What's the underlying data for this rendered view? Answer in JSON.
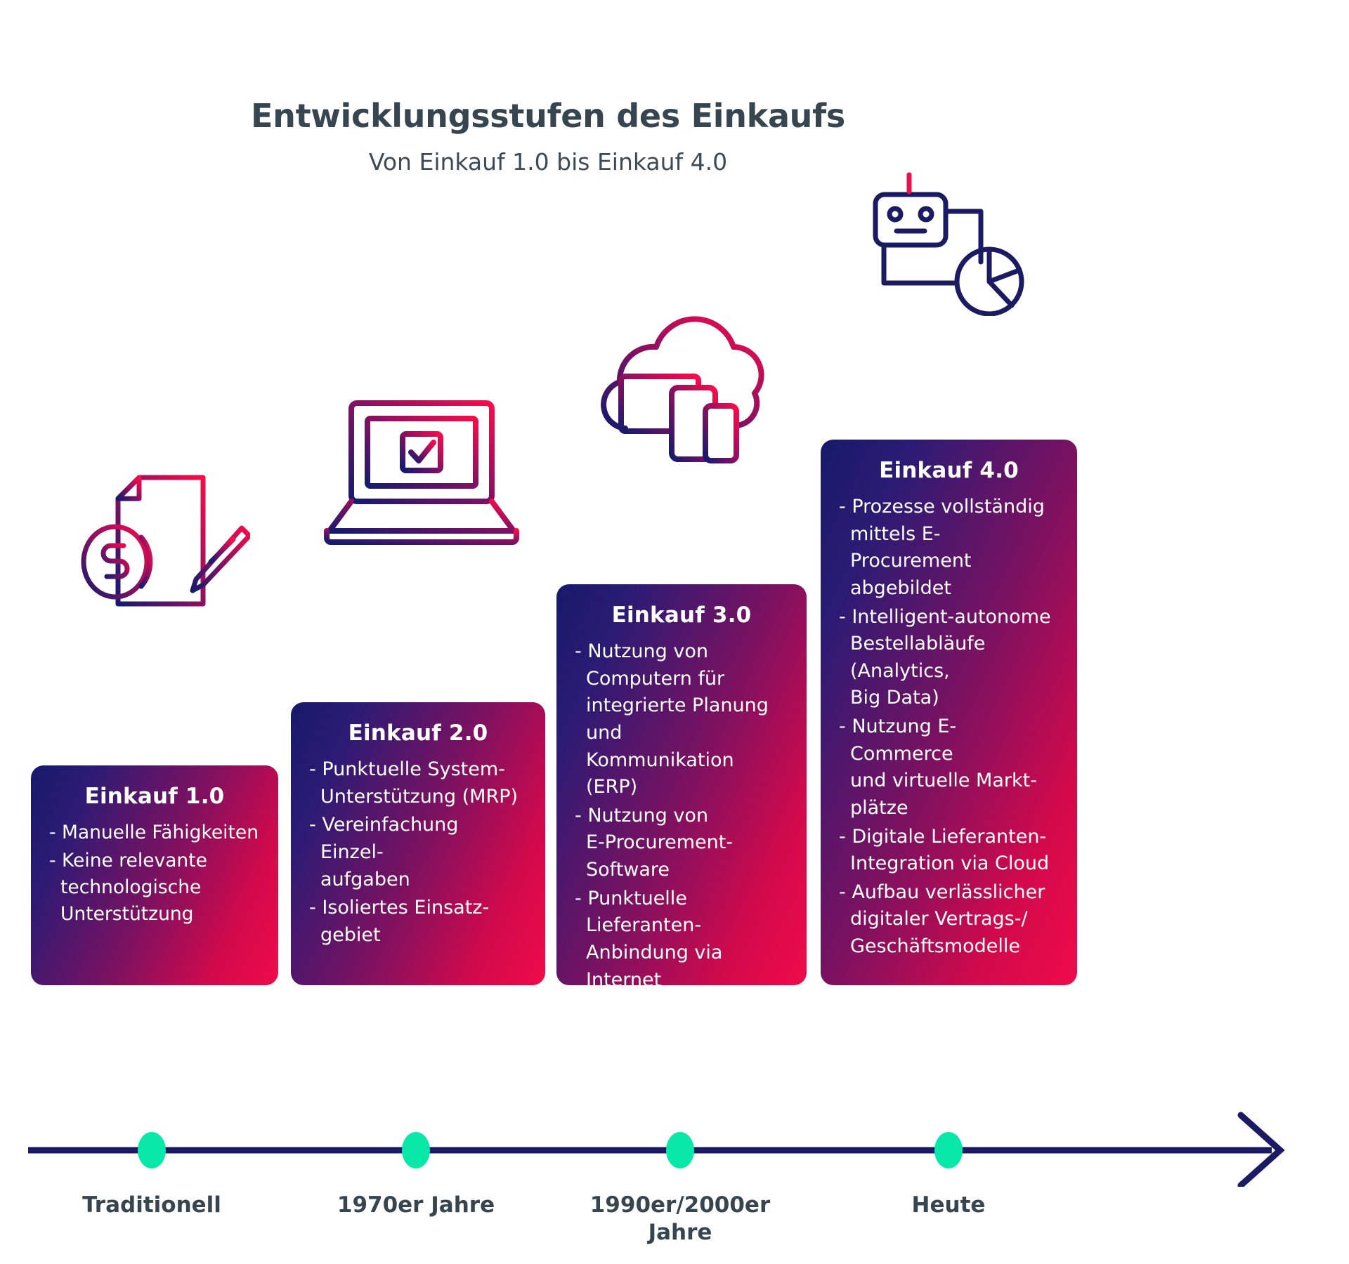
{
  "header": {
    "title": "Entwicklungsstufen des Einkaufs",
    "subtitle": "Von Einkauf 1.0 bis Einkauf 4.0"
  },
  "colors": {
    "gradient_start": "#171a6b",
    "gradient_end": "#f00b4a",
    "heading_text": "#36454f",
    "timeline_line": "#1b1b63",
    "timeline_dot": "#07e8a9",
    "card_text": "#ffffff"
  },
  "stages": [
    {
      "id": "einkauf-1",
      "title": "Einkauf 1.0",
      "icon": "document-coin-chart-pencil-icon",
      "bullets": [
        "- Manuelle Fähigkeiten",
        "- Keine relevante\ntechnologische\nUnterstützung"
      ]
    },
    {
      "id": "einkauf-2",
      "title": "Einkauf 2.0",
      "icon": "laptop-checkmark-icon",
      "bullets": [
        "- Punktuelle System-\nUnterstützung (MRP)",
        "- Vereinfachung Einzel-\naufgaben",
        "- Isoliertes Einsatz-\ngebiet"
      ]
    },
    {
      "id": "einkauf-3",
      "title": "Einkauf 3.0",
      "icon": "cloud-devices-icon",
      "bullets": [
        "- Nutzung von\nComputern für\nintegrierte Planung und\nKommunikation (ERP)",
        "- Nutzung von\nE-Procurement-\nSoftware",
        "- Punktuelle Lieferanten-\nAnbindung via Internet"
      ]
    },
    {
      "id": "einkauf-4",
      "title": "Einkauf 4.0",
      "icon": "robot-piechart-icon",
      "bullets": [
        "- Prozesse vollständig\nmittels E-Procurement\nabgebildet",
        "- Intelligent-autonome\nBestellabläufe (Analytics,\nBig Data)",
        "- Nutzung E-Commerce\nund virtuelle Markt-\nplätze",
        "- Digitale Lieferanten-\nIntegration via Cloud",
        "- Aufbau verlässlicher\ndigitaler Vertrags-/\nGeschäftsmodelle"
      ]
    }
  ],
  "timeline": {
    "arrow_icon": "arrow-right-icon",
    "points": [
      {
        "label": "Traditionell"
      },
      {
        "label": "1970er Jahre"
      },
      {
        "label": "1990er/2000er\nJahre"
      },
      {
        "label": "Heute"
      }
    ]
  }
}
